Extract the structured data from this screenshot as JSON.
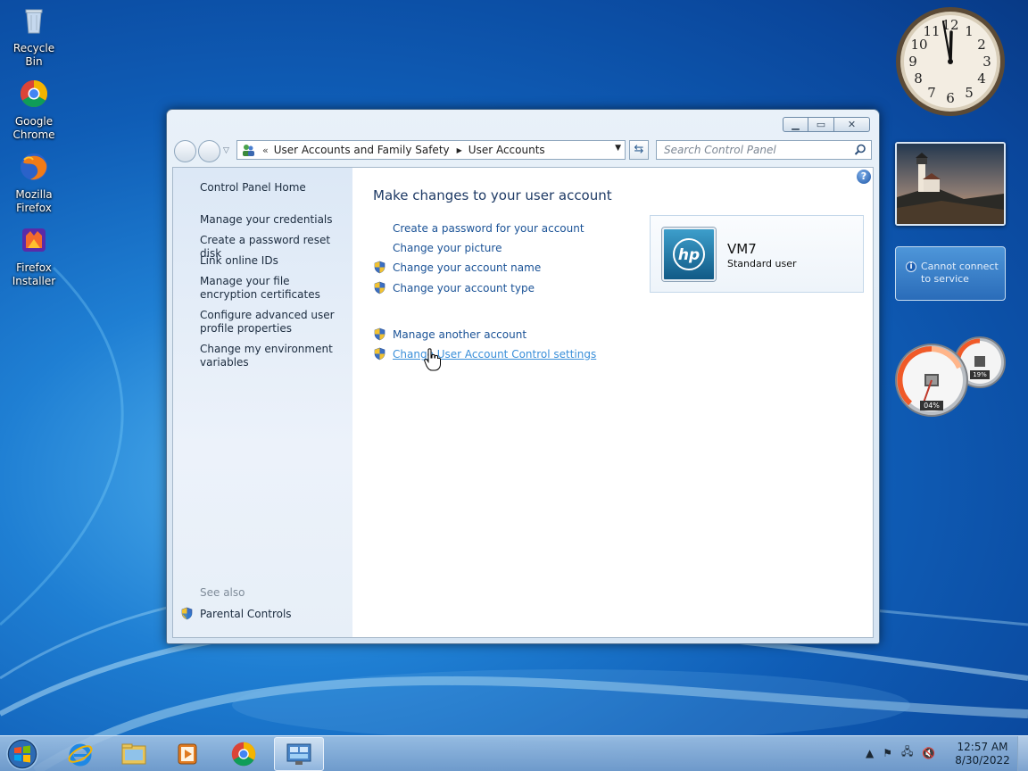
{
  "desktop": {
    "icons": [
      {
        "label": "Recycle Bin",
        "icon": "recycle-bin-icon"
      },
      {
        "label": "Google Chrome",
        "icon": "chrome-icon"
      },
      {
        "label": "Mozilla Firefox",
        "icon": "firefox-icon"
      },
      {
        "label": "Firefox Installer",
        "icon": "firefox-installer-icon"
      }
    ]
  },
  "window": {
    "breadcrumb": {
      "overflow": "«",
      "items": [
        "User Accounts and Family Safety",
        "User Accounts"
      ]
    },
    "search_placeholder": "Search Control Panel",
    "sidebar": {
      "home": "Control Panel Home",
      "links": [
        "Manage your credentials",
        "Create a password reset disk",
        "Link online IDs",
        "Manage your file encryption certificates",
        "Configure advanced user profile properties",
        "Change my environment variables"
      ],
      "see_also": "See also",
      "parental_controls": "Parental Controls"
    },
    "main": {
      "title": "Make changes to your user account",
      "tasks": [
        {
          "label": "Create a password for your account",
          "shield": false
        },
        {
          "label": "Change your picture",
          "shield": false
        },
        {
          "label": "Change your account name",
          "shield": true
        },
        {
          "label": "Change your account type",
          "shield": true
        }
      ],
      "other_tasks": [
        {
          "label": "Manage another account",
          "shield": true
        },
        {
          "label": "Change User Account Control settings",
          "shield": true
        }
      ]
    },
    "account": {
      "name": "VM7",
      "type": "Standard user",
      "picture_text": "hp"
    }
  },
  "gadgets": {
    "weather_message": "Cannot connect to service",
    "cpu_percent": "04%",
    "memory_percent": "19%",
    "clock": {
      "hour": 12,
      "minute": 57
    }
  },
  "taskbar": {
    "time": "12:57 AM",
    "date": "8/30/2022"
  },
  "colors": {
    "link": "#1a5296",
    "link_hover": "#3a8fd9",
    "title": "#1e3a65"
  }
}
